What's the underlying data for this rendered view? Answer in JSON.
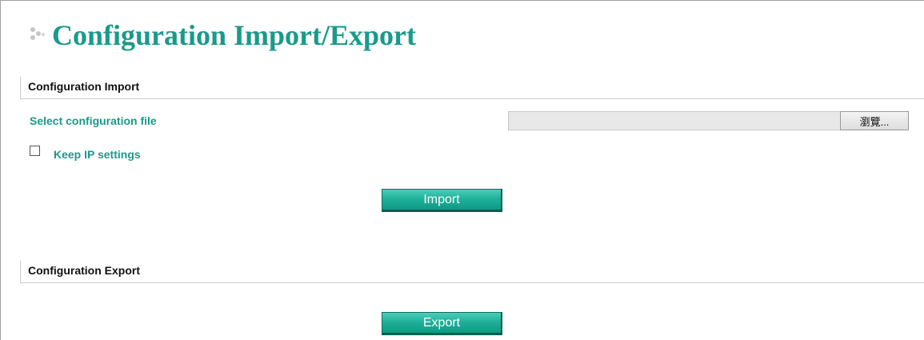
{
  "page": {
    "title": "Configuration Import/Export"
  },
  "import_section": {
    "header": "Configuration Import",
    "file_label": "Select configuration file",
    "file_value": "",
    "browse_label": "瀏覽...",
    "keep_ip_label": "Keep IP settings",
    "keep_ip_checked": false,
    "import_button": "Import"
  },
  "export_section": {
    "header": "Configuration Export",
    "export_button": "Export"
  },
  "colors": {
    "accent": "#1a9a8a",
    "button_green": "#20b09a",
    "header_text": "#111111"
  },
  "icons": {
    "title_bullet": "dots-bullet-icon"
  }
}
